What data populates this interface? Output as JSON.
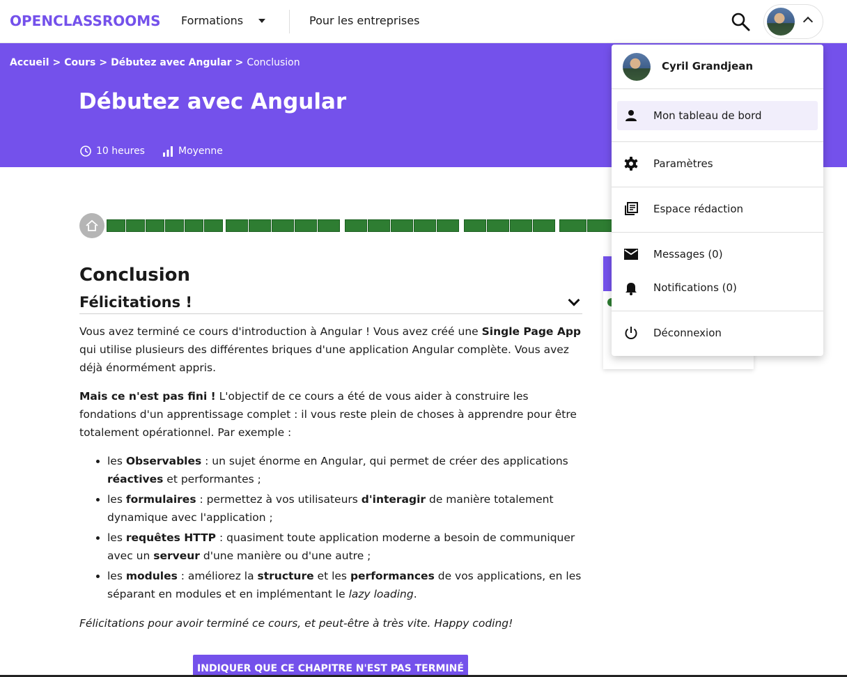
{
  "nav": {
    "logo": "OPENCLASSROOMS",
    "formations": "Formations",
    "entreprises": "Pour les entreprises"
  },
  "breadcrumb": {
    "items": [
      "Accueil",
      "Cours",
      "Débutez avec Angular"
    ],
    "current": "Conclusion",
    "separator": ">"
  },
  "course": {
    "title": "Débutez avec Angular",
    "duration": "10 heures",
    "difficulty": "Moyenne"
  },
  "progress": {
    "groups": [
      6,
      5,
      5,
      4,
      3
    ],
    "completed_color": "#2e7d32"
  },
  "chapter": {
    "title": "Conclusion",
    "section_title": "Félicitations !",
    "p1": {
      "a": "Vous avez terminé ce cours d'introduction à Angular ! Vous avez créé une ",
      "b": "Single Page App",
      "c": " qui utilise plusieurs des différentes briques d'une application Angular complète. Vous avez déjà énormément appris."
    },
    "p2": {
      "b": "Mais ce n'est pas fini !",
      "c": " L'objectif de ce cours a été de vous aider à construire les fondations d'un apprentissage complet : il vous reste plein de choses à apprendre pour être totalement opérationnel. Par exemple :"
    },
    "list": [
      {
        "t1": "les ",
        "b1": "Observables",
        "t2": " : un sujet énorme en Angular, qui permet de créer des applications ",
        "b2": "réactives",
        "t3": " et performantes ;"
      },
      {
        "t1": "les ",
        "b1": "formulaires",
        "t2": " : permettez à vos utilisateurs ",
        "b2": "d'interagir",
        "t3": " de manière totalement dynamique avec l'application ;"
      },
      {
        "t1": "les ",
        "b1": "requêtes HTTP",
        "t2": " : quasiment toute application moderne a besoin de communiquer avec un ",
        "b2": "serveur",
        "t3": " d'une manière ou d'une autre ;"
      },
      {
        "t1": "les ",
        "b1": "modules",
        "t2": " : améliorez la ",
        "b2": "structure",
        "t3": " et les ",
        "b3": "performances",
        "t4": " de vos applications, en les séparant en modules et en implémentant le ",
        "i1": "lazy loading",
        "t5": "."
      }
    ],
    "closing": "Félicitations pour avoir terminé ce cours, et peut-être à très vite. Happy coding!",
    "button_not_done": "INDIQUER QUE CE CHAPITRE N'EST PAS TERMINÉ"
  },
  "user_menu": {
    "name": "Cyril Grandjean",
    "dashboard": "Mon tableau de bord",
    "settings": "Paramètres",
    "redaction": "Espace rédaction",
    "messages": "Messages (0)",
    "notifications": "Notifications (0)",
    "logout": "Déconnexion"
  },
  "colors": {
    "brand": "#7451eb",
    "progress_done": "#2e7d32"
  },
  "icons": [
    "search-icon",
    "chevron-up-icon",
    "caret-down-icon",
    "clock-icon",
    "bar-chart-icon",
    "home-icon",
    "chevron-down-icon",
    "person-icon",
    "gear-icon",
    "library-books-icon",
    "mail-icon",
    "bell-icon",
    "power-icon"
  ]
}
